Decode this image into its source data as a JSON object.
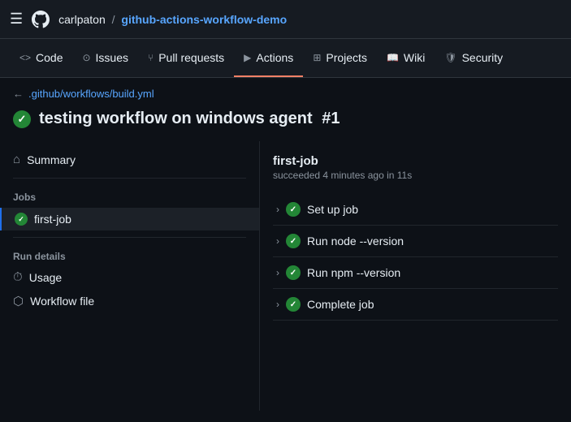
{
  "topbar": {
    "username": "carlpaton",
    "slash": "/",
    "reponame": "github-actions-workflow-demo"
  },
  "nav": {
    "tabs": [
      {
        "id": "code",
        "label": "Code",
        "icon": "<>",
        "active": false
      },
      {
        "id": "issues",
        "label": "Issues",
        "icon": "⊙",
        "active": false
      },
      {
        "id": "pull-requests",
        "label": "Pull requests",
        "icon": "⑂",
        "active": false
      },
      {
        "id": "actions",
        "label": "Actions",
        "icon": "▶",
        "active": true
      },
      {
        "id": "projects",
        "label": "Projects",
        "icon": "⊞",
        "active": false
      },
      {
        "id": "wiki",
        "label": "Wiki",
        "icon": "📖",
        "active": false
      },
      {
        "id": "security",
        "label": "Security",
        "icon": "🛡",
        "active": false
      }
    ]
  },
  "breadcrumb": {
    "path": ".github/workflows/build.yml"
  },
  "workflow": {
    "title": "testing workflow on windows agent",
    "run_number": "#1"
  },
  "sidebar": {
    "summary_label": "Summary",
    "jobs_label": "Jobs",
    "job_name": "first-job",
    "run_details_label": "Run details",
    "usage_label": "Usage",
    "workflow_file_label": "Workflow file"
  },
  "job_panel": {
    "name": "first-job",
    "meta": "succeeded 4 minutes ago in 11s",
    "steps": [
      {
        "id": "setup",
        "label": "Set up job"
      },
      {
        "id": "node",
        "label": "Run node --version"
      },
      {
        "id": "npm",
        "label": "Run npm --version"
      },
      {
        "id": "complete",
        "label": "Complete job"
      }
    ]
  }
}
